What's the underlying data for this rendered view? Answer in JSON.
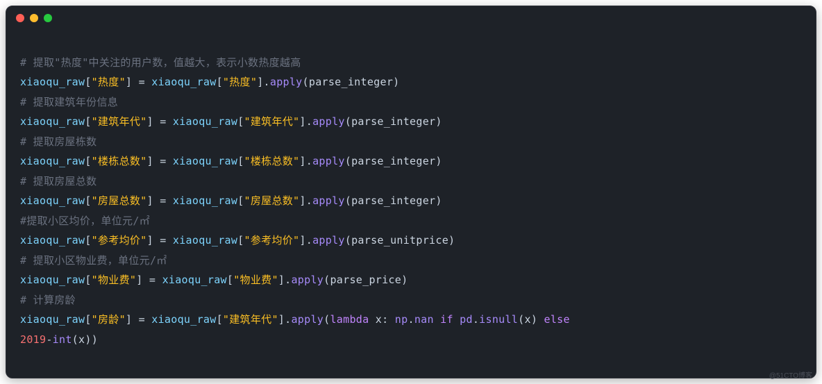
{
  "window": {
    "dots": [
      "close",
      "minimize",
      "maximize"
    ]
  },
  "watermark": "@51CTO博客",
  "code": {
    "comment1": "# 提取\"热度\"中关注的用户数，值越大，表示小数热度越高",
    "line1": {
      "var": "xiaoqu_raw",
      "key": "\"热度\"",
      "op": " = ",
      "var2": "xiaoqu_raw",
      "key2": "\"热度\"",
      "call": "apply",
      "arg": "parse_integer"
    },
    "comment2": "# 提取建筑年份信息",
    "line2": {
      "var": "xiaoqu_raw",
      "key": "\"建筑年代\"",
      "op": " = ",
      "var2": "xiaoqu_raw",
      "key2": "\"建筑年代\"",
      "call": "apply",
      "arg": "parse_integer"
    },
    "comment3": "# 提取房屋栋数",
    "line3": {
      "var": "xiaoqu_raw",
      "key": "\"楼栋总数\"",
      "op": " = ",
      "var2": "xiaoqu_raw",
      "key2": "\"楼栋总数\"",
      "call": "apply",
      "arg": "parse_integer"
    },
    "comment4": "# 提取房屋总数",
    "line4": {
      "var": "xiaoqu_raw",
      "key": "\"房屋总数\"",
      "op": " = ",
      "var2": "xiaoqu_raw",
      "key2": "\"房屋总数\"",
      "call": "apply",
      "arg": "parse_integer"
    },
    "comment5": "#提取小区均价，单位元/㎡",
    "line5": {
      "var": "xiaoqu_raw",
      "key": "\"参考均价\"",
      "op": " = ",
      "var2": "xiaoqu_raw",
      "key2": "\"参考均价\"",
      "call": "apply",
      "arg": "parse_unitprice"
    },
    "comment6": "# 提取小区物业费，单位元/㎡",
    "line6": {
      "var": "xiaoqu_raw",
      "key": "\"物业费\"",
      "op": " = ",
      "var2": "xiaoqu_raw",
      "key2": "\"物业费\"",
      "call": "apply",
      "arg": "parse_price"
    },
    "comment7": "# 计算房龄",
    "line7": {
      "var": "xiaoqu_raw",
      "key": "\"房龄\"",
      "op": " = ",
      "var2": "xiaoqu_raw",
      "key2": "\"建筑年代\"",
      "call": "apply",
      "lambda_kw": "lambda",
      "lambda_arg": " x: ",
      "np": "np",
      "nan": "nan",
      "if": " if ",
      "pd": "pd",
      "isnull": "isnull",
      "isnull_arg": "x",
      "else": " else ",
      "year": "2019",
      "minus": "-",
      "int": "int",
      "int_arg": "x"
    }
  }
}
